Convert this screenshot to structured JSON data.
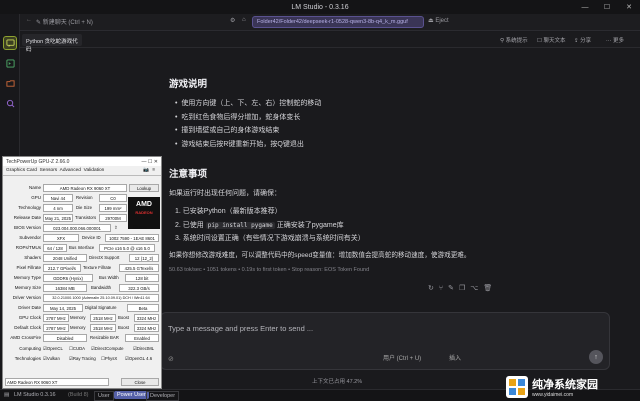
{
  "window": {
    "title": "LM Studio - 0.3.16",
    "min": "—",
    "max": "☐",
    "close": "✕"
  },
  "toolbar": {
    "new_chat": "新建聊天 (Ctrl + N)",
    "model_path": "Folder42/Folder42/deepseek-r1-0528-qwen3-8b-q4_k_m.gguf",
    "eject": "Eject"
  },
  "subbar": {
    "chat_tab": "Python 贪吃蛇游戏代码",
    "tools": [
      "系统提示",
      "聊天文本",
      "分享",
      "更多"
    ]
  },
  "content": {
    "h_game": "游戏说明",
    "game_items": [
      "使用方向键（上、下、左、右）控制蛇的移动",
      "吃到红色食物后得分增加，蛇身体变长",
      "撞到墙壁或自己的身体游戏结束",
      "游戏结束后按R键重新开始，按Q键退出"
    ],
    "h_notes": "注意事项",
    "notes_intro": "如果运行时出现任何问题，请确保：",
    "note_1": "已安装Python（最新版本推荐）",
    "note_2_pre": "已使用",
    "note_2_code": "pip install pygame",
    "note_2_post": "正确安装了pygame库",
    "note_3": "系统时间设置正确（有些情况下游戏崩溃与系统时间有关）",
    "tip": "如果你想修改游戏难度，可以调整代码中的speed变量值：增加数值会提高蛇的移动速度，使游戏更难。",
    "stats": "50.63 tok/sec • 1051 tokens • 0.19s to first token • Stop reason: EOS Token Found"
  },
  "input": {
    "placeholder": "Type a message and press Enter to send ...",
    "user_label": "用户 (Ctrl + U)",
    "insert_label": "插入"
  },
  "context_info": "上下文已占用 47.2%",
  "status": {
    "app": "LM Studio 0.3.16",
    "build": "(Build 8)",
    "user": "User",
    "power_user": "Power User",
    "developer": "Developer"
  },
  "gpuz": {
    "title": "TechPowerUp GPU-Z 2.66.0",
    "tabs": [
      "Graphics Card",
      "Sensors",
      "Advanced",
      "Validation"
    ],
    "lookup": "Lookup",
    "uefi": "UEFI",
    "rows": {
      "name": "AMD Radeon RX 9060 XT",
      "gpu": "Navi 44",
      "revision": "C0",
      "technology": "4 nm",
      "die_size": "199 mm²",
      "release": "May 21, 2025",
      "transistors": "29700M",
      "bios": "023.004.000.066.000001",
      "subvendor": "XFX",
      "device_id": "1002 7590 - 1EAE 8601",
      "rops": "64 / 128",
      "bus_interface": "PCIe x16 5.0 @ x16 5.0",
      "shaders": "2048 Unified",
      "directx": "12 (12_2)",
      "pixel_fill": "212.7 GPixel/s",
      "texture_fill": "425.5 GTexel/s",
      "mem_type": "GDDR6 (Hynix)",
      "bus_width": "128 bit",
      "mem_size": "16384 MB",
      "bandwidth": "322.3 GB/s",
      "driver_version": "32.0.21000.1000 (Adrenalin 25.10.09.01) DCH / Win11 64",
      "driver_date": "May 14, 2025",
      "digital_sig": "Beta",
      "gpu_clock": "2787 MHz",
      "mem_clock": "2518 MHz",
      "boost": "3324 MHz",
      "def_clock": "2787 MHz",
      "def_mem": "2518 MHz",
      "def_boost": "3324 MHz",
      "crossfire": "Disabled",
      "resizable_bar": "Enabled"
    },
    "labels": {
      "name": "Name",
      "gpu": "GPU",
      "revision": "Revision",
      "technology": "Technology",
      "die_size": "Die Size",
      "release": "Release Date",
      "transistors": "Transistors",
      "bios": "BIOS Version",
      "subvendor": "Subvendor",
      "device_id": "Device ID",
      "rops": "ROPs/TMUs",
      "bus_interface": "Bus Interface",
      "shaders": "Shaders",
      "directx": "DirectX Support",
      "pixel_fill": "Pixel Fillrate",
      "texture_fill": "Texture Fillrate",
      "mem_type": "Memory Type",
      "bus_width": "Bus Width",
      "mem_size": "Memory Size",
      "bandwidth": "Bandwidth",
      "driver_version": "Driver Version",
      "driver_date": "Driver Date",
      "digital_sig": "Digital Signature",
      "gpu_clock": "GPU Clock",
      "memory": "Memory",
      "boost": "Boost",
      "default_clock": "Default Clock",
      "crossfire": "AMD CrossFire",
      "resizable_bar": "Resizable BAR",
      "computing": "Computing",
      "technologies": "Technologies"
    },
    "computing": [
      "OpenCL",
      "CUDA",
      "DirectCompute",
      "DirectML"
    ],
    "technologies": [
      "Vulkan",
      "Ray Tracing",
      "PhysX",
      "OpenGL 4.6"
    ],
    "logo_text": "AMD",
    "logo_sub": "RADEON",
    "card_select": "AMD Radeon RX 9060 XT",
    "close": "Close"
  },
  "watermark": {
    "text": "纯净系统家园",
    "url": "www.yidaimei.com"
  }
}
